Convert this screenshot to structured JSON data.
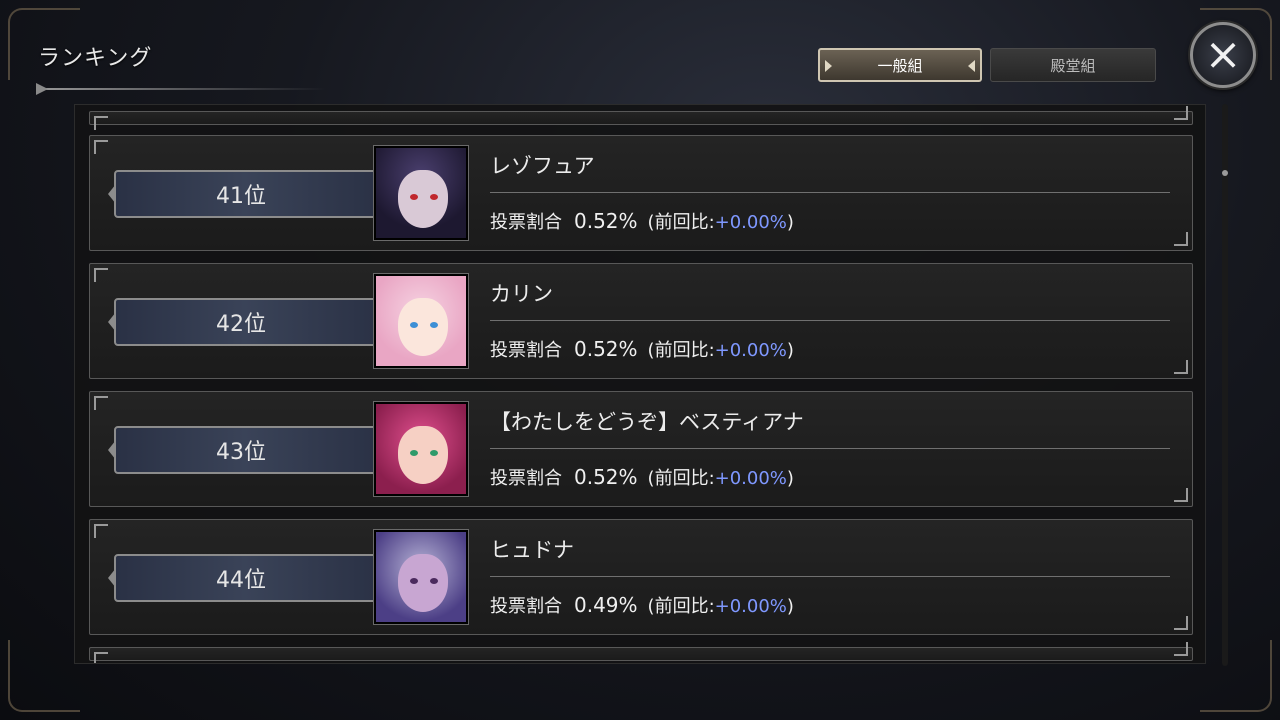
{
  "screen": {
    "title": "ランキング",
    "tabs": [
      {
        "label": "一般組",
        "active": true
      },
      {
        "label": "殿堂組",
        "active": false
      }
    ],
    "close_label": "×"
  },
  "labels": {
    "vote_share": "投票割合",
    "prev_open": "(前回比:",
    "prev_close": ")"
  },
  "colors": {
    "diff_text": "#7f98ff",
    "active_tab_border": "#cfc6b2"
  },
  "rankings": [
    {
      "rank": "41位",
      "name": "レゾフュア",
      "share": "0.52%",
      "diff": "+0.00%",
      "portrait": "dark-hooded-girl"
    },
    {
      "rank": "42位",
      "name": "カリン",
      "share": "0.52%",
      "diff": "+0.00%",
      "portrait": "pink-haired-fox-girl"
    },
    {
      "rank": "43位",
      "name": "【わたしをどうぞ】ベスティアナ",
      "share": "0.52%",
      "diff": "+0.00%",
      "portrait": "magenta-haired-girl"
    },
    {
      "rank": "44位",
      "name": "ヒュドナ",
      "share": "0.49%",
      "diff": "+0.00%",
      "portrait": "silver-haired-woman"
    }
  ]
}
